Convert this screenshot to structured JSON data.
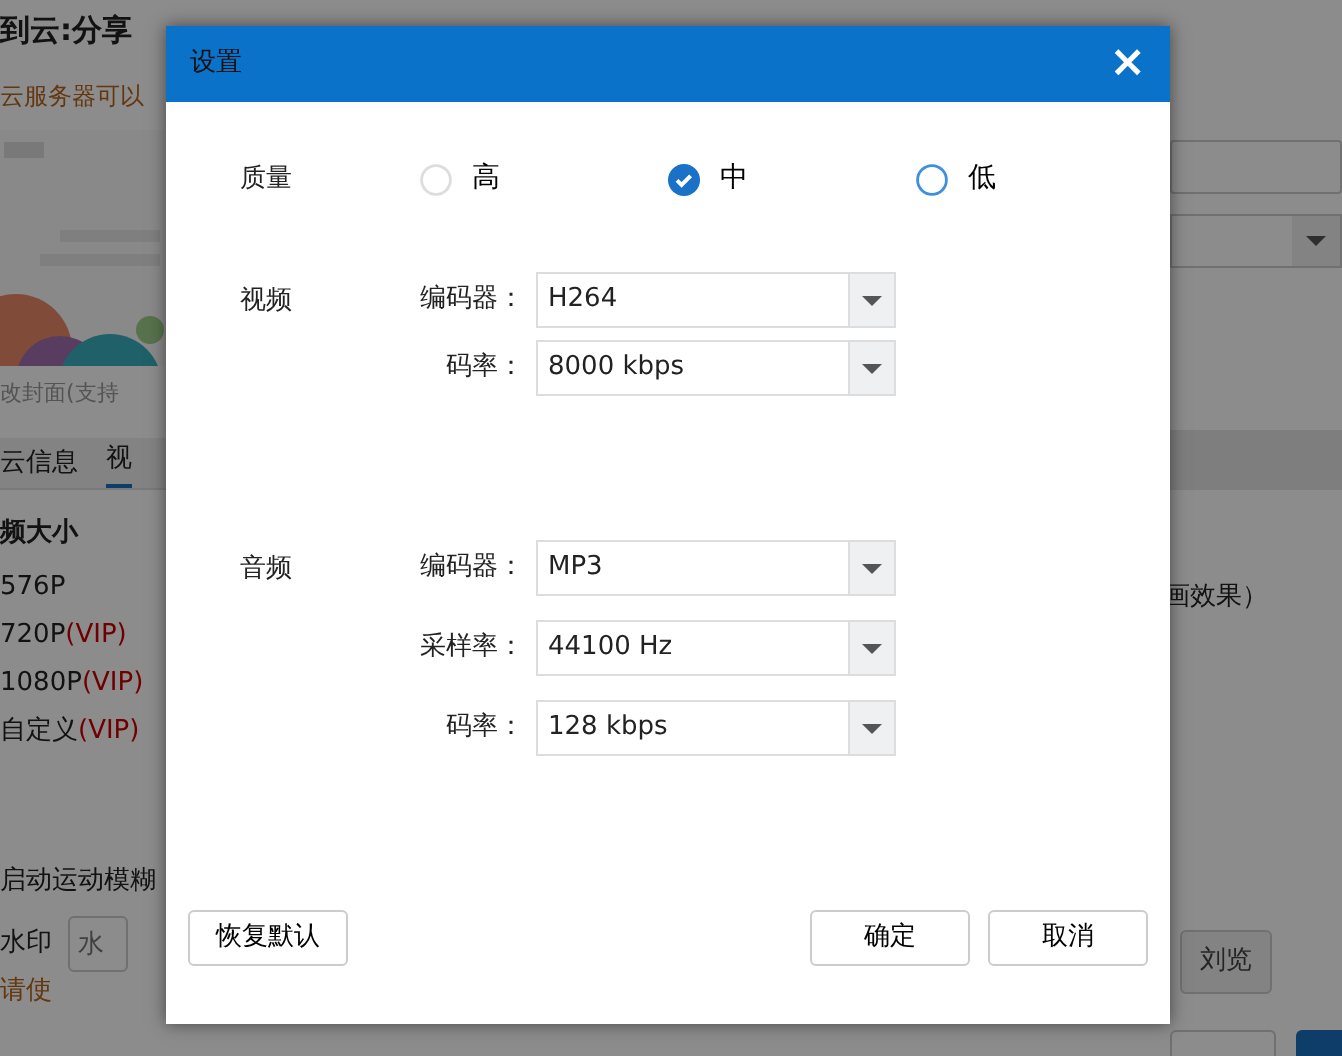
{
  "background": {
    "title": "到云:分享",
    "subtitle": "云服务器可以",
    "cover_hint": "改封面(支持",
    "tabs": [
      {
        "label": "云信息",
        "selected": false
      },
      {
        "label": "视",
        "selected": true
      }
    ],
    "size_heading": "频大小",
    "sizes": [
      {
        "label": "576P"
      },
      {
        "label": "720P",
        "vip": "(VIP)"
      },
      {
        "label": "1080P",
        "vip": "(VIP)"
      },
      {
        "label": "自定义",
        "vip": "(VIP)"
      }
    ],
    "motion_blur": "启动运动模糊",
    "watermark_label": "水印",
    "watermark_placeholder": "水",
    "watermark_note": "请使",
    "effect_note": "画效果）",
    "browse_button": "刘览"
  },
  "dialog": {
    "title": "设置",
    "close": "×",
    "quality": {
      "label": "质量",
      "options": [
        {
          "label": "高",
          "selected": false,
          "highlighted": false
        },
        {
          "label": "中",
          "selected": true,
          "highlighted": false
        },
        {
          "label": "低",
          "selected": false,
          "highlighted": true
        }
      ]
    },
    "sections": [
      {
        "label": "视频",
        "fields": [
          {
            "label": "编码器：",
            "value": "H264"
          },
          {
            "label": "码率：",
            "value": "8000 kbps"
          }
        ]
      },
      {
        "label": "音频",
        "fields": [
          {
            "label": "编码器：",
            "value": "MP3"
          },
          {
            "label": "采样率：",
            "value": "44100 Hz"
          },
          {
            "label": "码率：",
            "value": "128 kbps"
          }
        ]
      }
    ],
    "buttons": [
      {
        "label": "恢复默认",
        "kind": "reset"
      },
      {
        "label": "确定",
        "kind": "ok"
      },
      {
        "label": "取消",
        "kind": "cancel"
      }
    ]
  }
}
